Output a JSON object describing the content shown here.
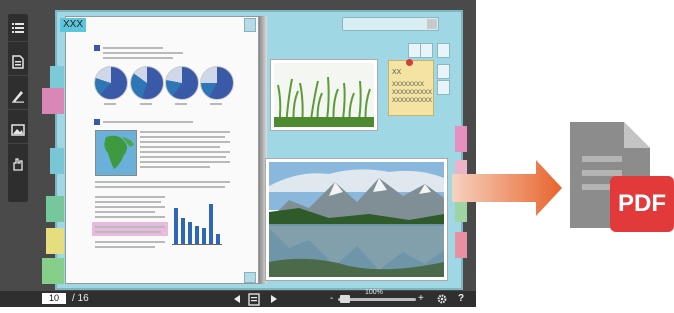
{
  "toolbar": {
    "icons": [
      "menu-list-icon",
      "document-icon",
      "pen-icon",
      "image-icon",
      "hand-icon"
    ]
  },
  "left_page": {
    "title_label": "XXX"
  },
  "search": {
    "placeholder": ""
  },
  "note": {
    "title": "XX",
    "lines": [
      "XXXXXXXX",
      "XXXXXXXXXX",
      "XXXXXXXXXX"
    ]
  },
  "pager": {
    "current_page": "10",
    "total_pages": "/ 16"
  },
  "zoom": {
    "level": "100%",
    "minus": "-",
    "plus": "+",
    "help": "?"
  },
  "pdf_badge": {
    "label": "PDF"
  },
  "colors": {
    "book_bg": "#9fd8e4",
    "arrow_orange": "#e8642c",
    "pdf_red": "#e23a3a",
    "doc_gray": "#8c8c8c"
  }
}
